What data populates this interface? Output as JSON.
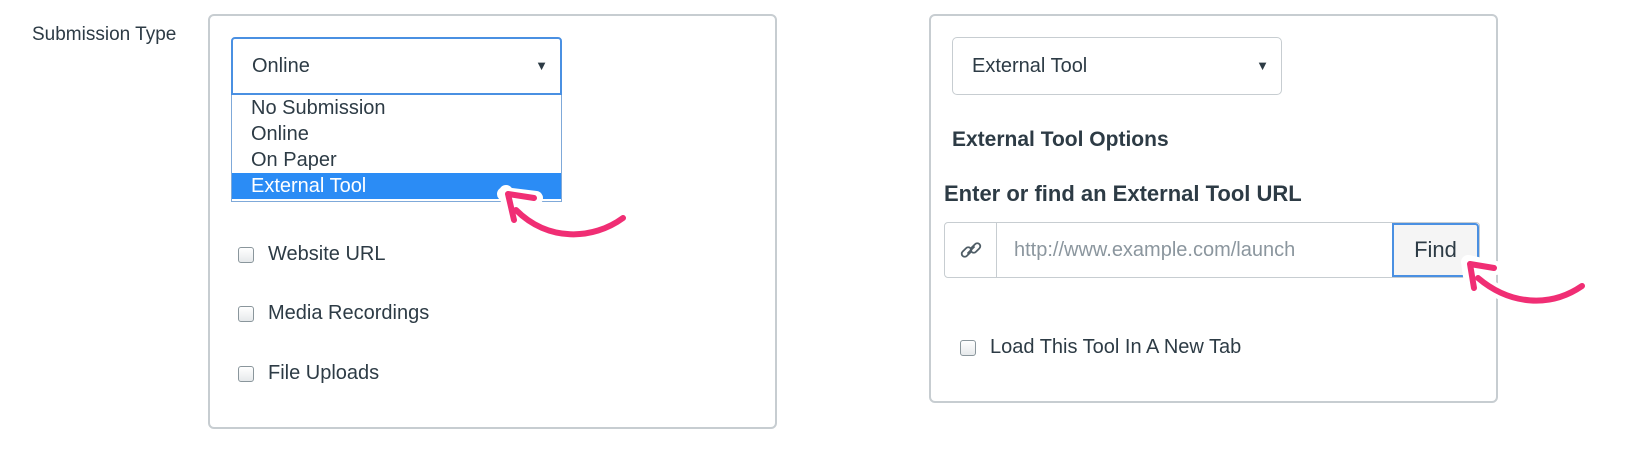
{
  "left": {
    "field_label": "Submission Type",
    "select": {
      "value": "Online",
      "arrow": "▼"
    },
    "dropdown": {
      "options": [
        {
          "label": "No Submission"
        },
        {
          "label": "Online"
        },
        {
          "label": "On Paper"
        },
        {
          "label": "External Tool"
        }
      ]
    },
    "checkboxes": [
      {
        "label": "Website URL"
      },
      {
        "label": "Media Recordings"
      },
      {
        "label": "File Uploads"
      }
    ]
  },
  "right": {
    "select": {
      "value": "External Tool",
      "arrow": "▼"
    },
    "section_title": "External Tool Options",
    "url_label": "Enter or find an External Tool URL",
    "url_input": {
      "value": "",
      "placeholder": "http://www.example.com/launch"
    },
    "find_label": "Find",
    "new_tab_label": "Load This Tool In A New Tab"
  },
  "colors": {
    "accent": "#4a90e2",
    "selected": "#2b8cf5",
    "annotation_arrow": "#f02e74"
  }
}
